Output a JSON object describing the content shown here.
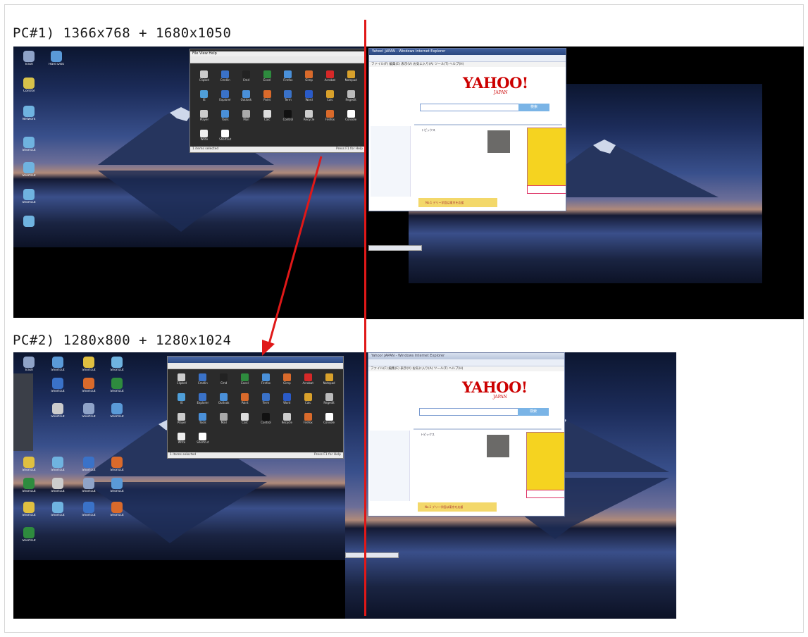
{
  "headings": {
    "pc1": "PC#1) 1366x768 + 1680x1050",
    "pc2": "PC#2) 1280x800 + 1280x1024"
  },
  "pc1_left_icons": [
    "Trash",
    "Hard Disk",
    "Control",
    "Network",
    "Shortcut",
    "Shortcut",
    "Shortcut"
  ],
  "pc2_left_icons": [
    "Trash",
    "Shortcut",
    "Shortcut",
    "Shortcut",
    "Shortcut",
    "Shortcut",
    "Shortcut",
    "Shortcut",
    "Shortcut",
    "Shortcut",
    "Shortcut",
    "Shortcut",
    "Shortcut",
    "Shortcut",
    "Shortcut",
    "Shortcut",
    "Shortcut",
    "Shortcut",
    "Shortcut",
    "Shortcut",
    "Shortcut",
    "Shortcut",
    "Shortcut"
  ],
  "program_window": {
    "menu": "File  View  Help",
    "status_left": "1 items selected",
    "status_right": "Press F1 for Help",
    "icons": [
      "Clipbrd",
      "Cmdlin",
      "Cmd",
      "Excel",
      "Firefox",
      "Gimp",
      "Acrobat",
      "Notepad",
      "IE",
      "Explorer",
      "Outlook",
      "Paint",
      "Term",
      "Word",
      "Calc",
      "Regedit",
      "Player",
      "Tools",
      "Mail",
      "Calc",
      "Control",
      "Recycle",
      "Firefox",
      "Console",
      "Write",
      "Shortcut"
    ],
    "icon_colors": [
      "#cccccc",
      "#3a72c8",
      "#222222",
      "#2e8b3e",
      "#4a90d9",
      "#d96a2b",
      "#d62828",
      "#d9a12b",
      "#4f9fd9",
      "#3a72c8",
      "#4a90d9",
      "#d96a2b",
      "#3a72c8",
      "#2a5bc8",
      "#d9a12b",
      "#bbbbbb",
      "#cccccc",
      "#4a90d9",
      "#aaaaaa",
      "#dddddd",
      "#111111",
      "#cccccc",
      "#d96a2b",
      "#ffffff",
      "#eeeeee",
      "#ffffff"
    ]
  },
  "browser": {
    "title": "Yahoo! JAPAN - Windows Internet Explorer",
    "menu": "ファイル(F)  編集(E)  表示(V)  お気に入り(A)  ツール(T)  ヘルプ(H)",
    "logo": "YAHOO!",
    "logo_sub": "JAPAN",
    "search_button": "検索",
    "news_heading": "トピックス",
    "bottom_banner": "No.1 デリー学園は東京を応援"
  },
  "colors": {
    "divider": "#e01818",
    "arrow": "#e01818"
  }
}
